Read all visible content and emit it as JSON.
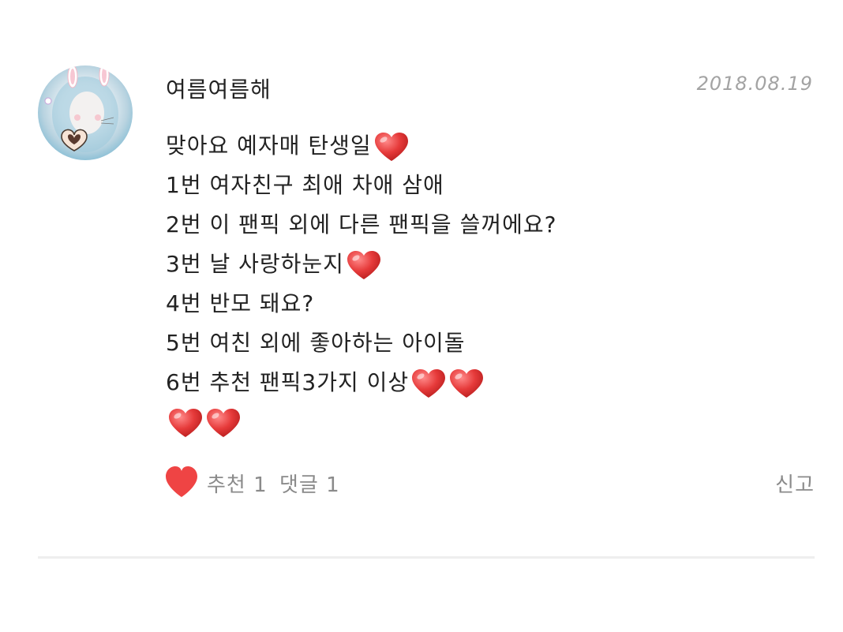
{
  "comment": {
    "author": "여름여름해",
    "date": "2018.08.19",
    "lines": [
      {
        "text": "맞아요 예자매 탄생일",
        "hearts": 1
      },
      {
        "text": "1번 여자친구 최애 차애 삼애",
        "hearts": 0
      },
      {
        "text": "2번 이 팬픽 외에 다른 팬픽을 쓸꺼에요?",
        "hearts": 0
      },
      {
        "text": "3번 날 사랑하눈지",
        "hearts": 1
      },
      {
        "text": "4번 반모 돼요?",
        "hearts": 0
      },
      {
        "text": "5번 여친 외에 좋아하는 아이돌",
        "hearts": 0
      },
      {
        "text": "6번 추천 팬픽3가지 이상",
        "hearts": 2
      },
      {
        "text": "",
        "hearts": 2
      }
    ],
    "footer": {
      "like_label": "추천 1",
      "comment_label": "댓글 1",
      "report_label": "신고"
    },
    "colors": {
      "heart": "#e63a3a",
      "like_heart": "#ef4444",
      "text": "#222222",
      "muted": "#8a8a8a",
      "divider": "#eeeeee"
    },
    "icons": {
      "avatar": "avatar-photo",
      "inline_heart": "heart-emoji-icon",
      "like": "heart-icon"
    }
  }
}
